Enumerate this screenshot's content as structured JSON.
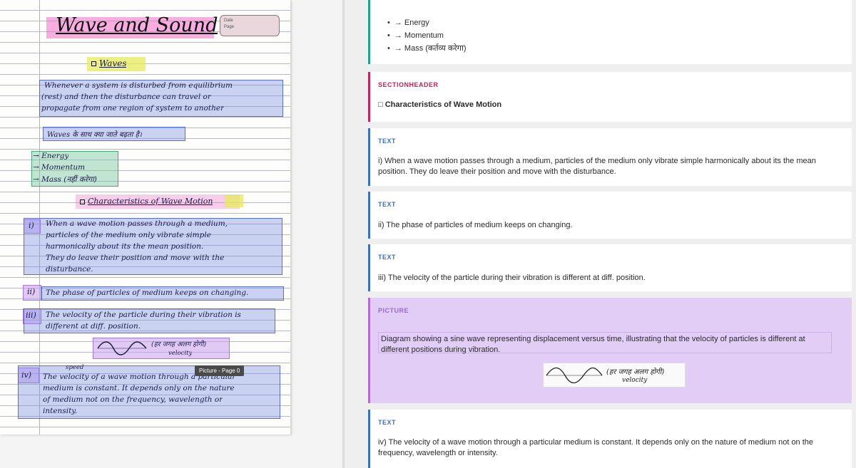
{
  "document": {
    "title": "Wave and Sound",
    "date_box": [
      "Date",
      "Page"
    ],
    "heading_waves": "Waves",
    "para1": [
      "Whenever a system is disturbed from equilibrium",
      "(rest) and then the disturbance can travel or",
      "propagate from one region of system to another"
    ],
    "hindi_line": "Waves के साथ क्या जाते बढ़ता है।",
    "list_items": [
      "Energy",
      "Momentum",
      "Mass (नहीं करेगा)"
    ],
    "heading_char": "Characteristics of Wave Motion",
    "point1": [
      "When a wave motion passes through a medium,",
      "particles of the medium only vibrate simple",
      "harmonically about its the mean position.",
      "They do leave their position and move with the",
      "disturbance."
    ],
    "point2": "The phase of particles of medium keeps on changing.",
    "point3": [
      "The velocity of the particle during their vibration is",
      "different at diff. position."
    ],
    "pic_note": "(हर जगह अलग होगी)",
    "pic_note_sub": "velocity",
    "point4_speed": "speed",
    "point4": [
      "The velocity of a wave motion through a particular",
      "medium is constant. It depends only on the nature",
      "of medium not on the frequency, wavelength or",
      "intensity."
    ],
    "roman": [
      "i)",
      "ii)",
      "iii)",
      "iv)"
    ],
    "tooltip": "Picture - Page 0"
  },
  "elements": {
    "list_card": {
      "items": [
        "→ Energy",
        "→ Momentum",
        "→ Mass (कर्तव्य करेगा)"
      ]
    },
    "section_card": {
      "label": "SECTIONHEADER",
      "text": "□ Characteristics of Wave Motion"
    },
    "text1": {
      "label": "TEXT",
      "text": "i) When a wave motion passes through a medium, particles of the medium only vibrate simple harmonically about its the mean position. They do leave their position and move with the disturbance."
    },
    "text2": {
      "label": "TEXT",
      "text": "ii) The phase of particles of medium keeps on changing."
    },
    "text3": {
      "label": "TEXT",
      "text": "iii) The velocity of the particle during their vibration is different at diff. position."
    },
    "picture": {
      "label": "PICTURE",
      "caption": "Diagram showing a sine wave representing displacement versus time, illustrating that the velocity of particles is different at different positions during vibration.",
      "thumb_text": "(हर जगह अलग होगी)",
      "thumb_sub": "velocity"
    },
    "text4": {
      "label": "TEXT",
      "text": "iv) The velocity of a wave motion through a particular medium is constant. It depends only on the nature of medium not on the frequency, wavelength or intensity."
    }
  }
}
